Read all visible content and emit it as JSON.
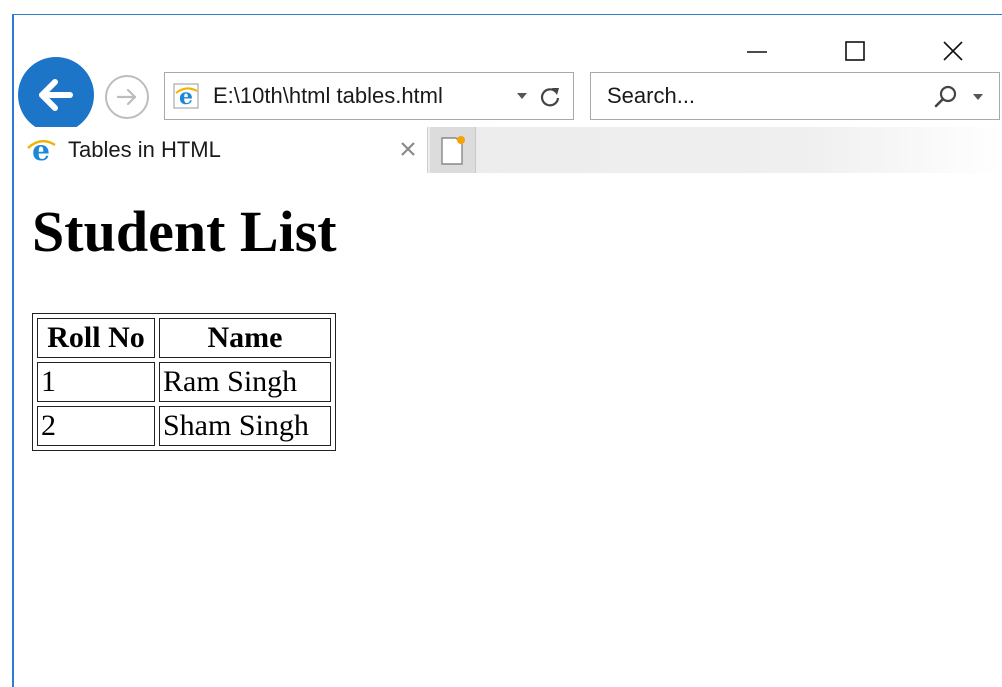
{
  "browser": {
    "address_url": "E:\\10th\\html tables.html",
    "search_placeholder": "Search...",
    "tab_title": "Tables in HTML",
    "accent_color": "#1d75c7",
    "icons": [
      "back-arrow-icon",
      "forward-arrow-icon",
      "ie-icon",
      "dropdown-icon",
      "refresh-icon",
      "search-icon",
      "close-icon",
      "new-tab-icon",
      "minimize-icon",
      "maximize-icon"
    ]
  },
  "page": {
    "heading": "Student List",
    "table": {
      "headers": [
        "Roll No",
        "Name"
      ],
      "rows": [
        [
          "1",
          "Ram Singh"
        ],
        [
          "2",
          "Sham Singh"
        ]
      ]
    }
  }
}
